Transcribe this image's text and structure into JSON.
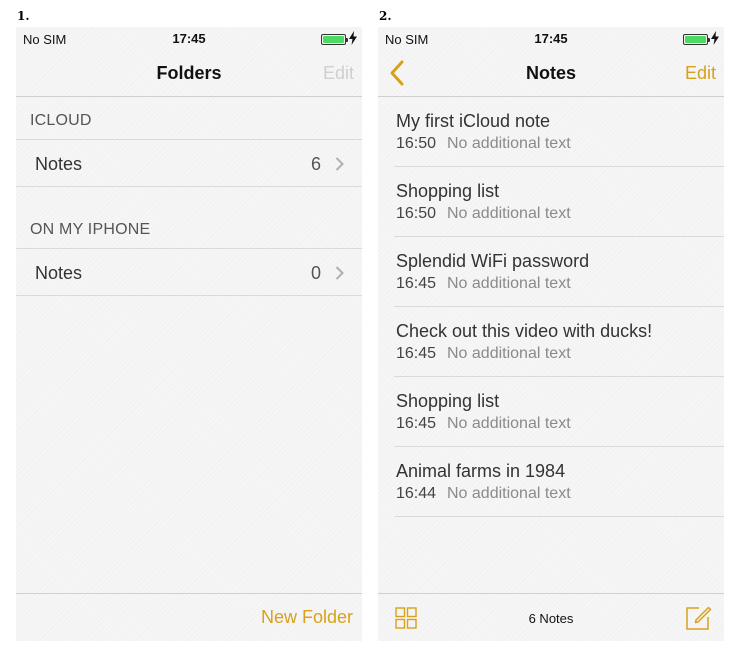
{
  "figure_labels": [
    "1.",
    "2."
  ],
  "colors": {
    "accent": "#d9a11a",
    "battery": "#4cd964",
    "disabled": "#cfcfcf"
  },
  "status_bar": {
    "carrier": "No SIM",
    "time": "17:45"
  },
  "screen1": {
    "title": "Folders",
    "edit_label": "Edit",
    "sections": [
      {
        "header": "ICLOUD",
        "folders": [
          {
            "name": "Notes",
            "count": "6"
          }
        ]
      },
      {
        "header": "ON MY IPHONE",
        "folders": [
          {
            "name": "Notes",
            "count": "0"
          }
        ]
      }
    ],
    "new_folder_label": "New Folder"
  },
  "screen2": {
    "title": "Notes",
    "edit_label": "Edit",
    "back_icon": "chevron-left-icon",
    "notes": [
      {
        "title": "My first iCloud note",
        "time": "16:50",
        "subtitle": "No additional text"
      },
      {
        "title": "Shopping list",
        "time": "16:50",
        "subtitle": "No additional text"
      },
      {
        "title": "Splendid WiFi password",
        "time": "16:45",
        "subtitle": "No additional text"
      },
      {
        "title": "Check out this video with ducks!",
        "time": "16:45",
        "subtitle": "No additional text"
      },
      {
        "title": "Shopping list",
        "time": "16:45",
        "subtitle": "No additional text"
      },
      {
        "title": "Animal farms in 1984",
        "time": "16:44",
        "subtitle": "No additional text"
      }
    ],
    "notes_count_label": "6 Notes",
    "toolbar_icons": [
      "attachments-grid-icon",
      "compose-icon"
    ]
  }
}
